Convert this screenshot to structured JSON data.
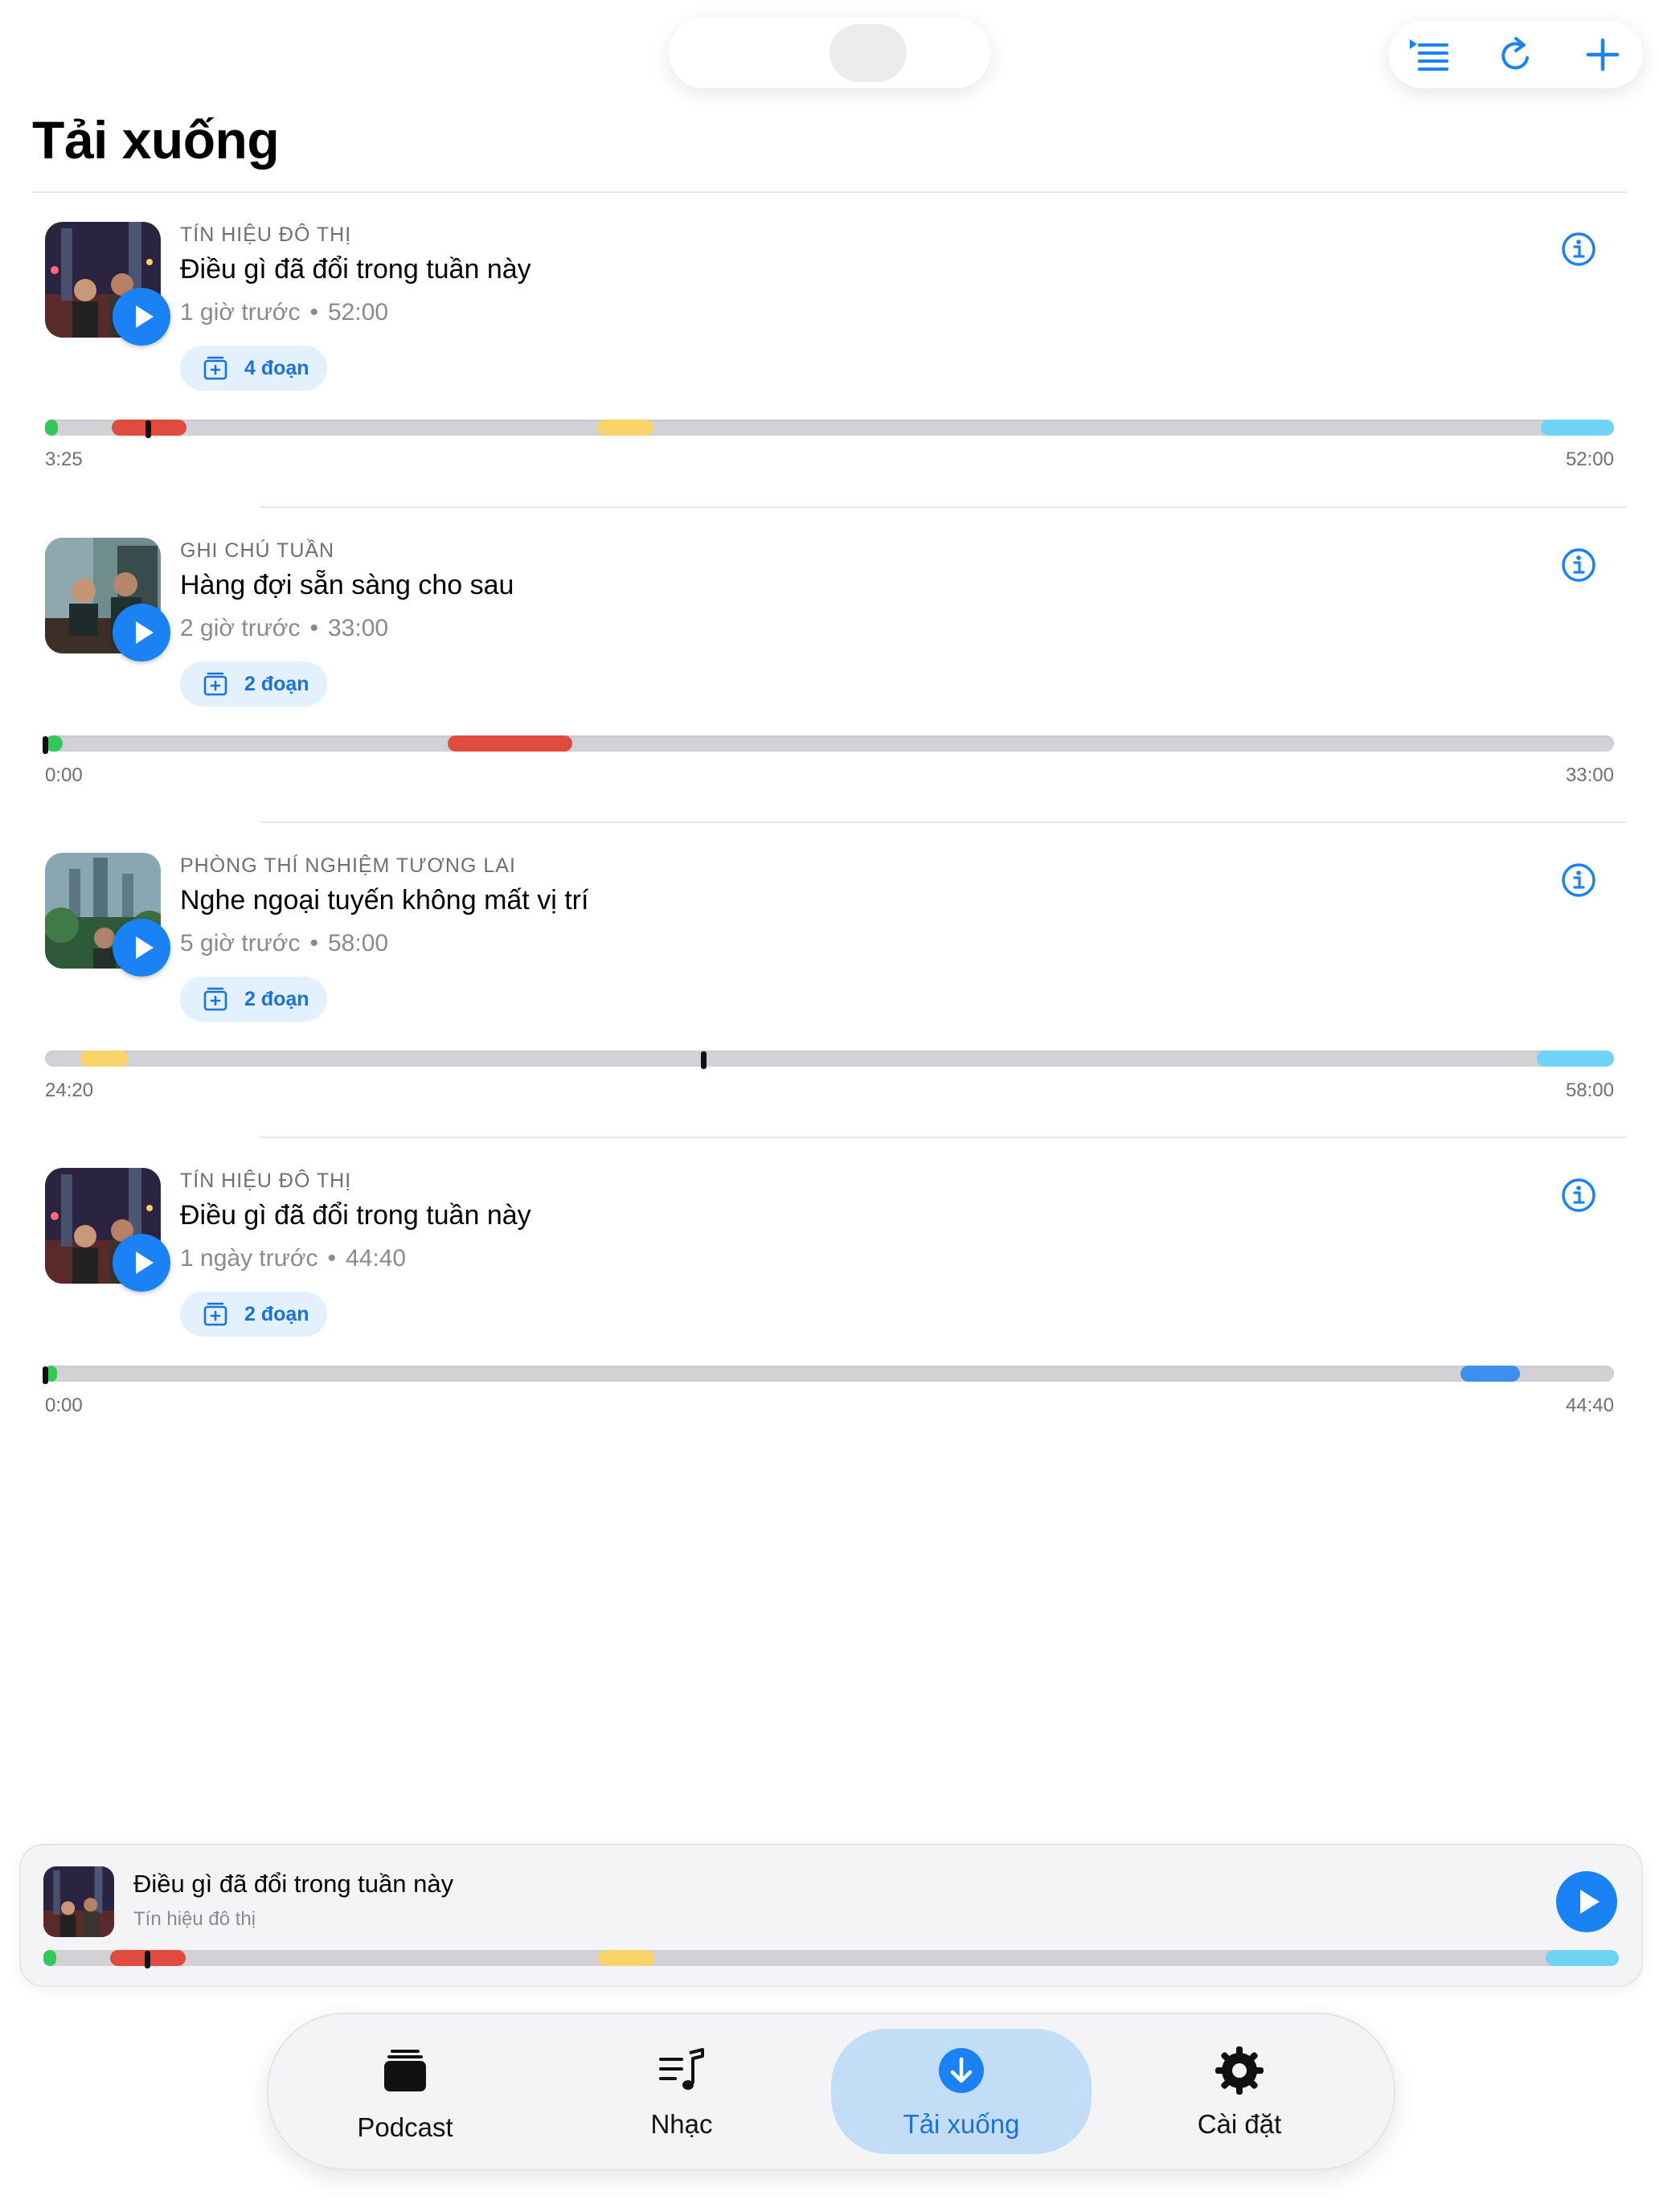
{
  "page": {
    "title": "Tải xuống"
  },
  "toolbar": {
    "icons": [
      "playlist-icon",
      "refresh-icon",
      "add-icon"
    ]
  },
  "colors": {
    "accent": "#1a82f5",
    "chip_bg": "#e3f0fd",
    "segment_green": "#34c759",
    "segment_red": "#e04b3f",
    "segment_yellow": "#f8d46a",
    "segment_cyan": "#6fd3f5",
    "segment_blue": "#3d8ff0"
  },
  "episodes": [
    {
      "show": "TÍN HIỆU ĐÔ THỊ",
      "title": "Điều gì đã đổi trong tuần này",
      "age": "1 giờ trước",
      "duration": "52:00",
      "chip": "4 đoạn",
      "art": "city-night",
      "timeline": {
        "start": "3:25",
        "end": "52:00",
        "duration_s": 3120,
        "position_s": 205,
        "segments": [
          {
            "color": "green",
            "from_s": 0,
            "to_s": 25
          },
          {
            "color": "red",
            "from_s": 132,
            "to_s": 282
          },
          {
            "color": "yellow",
            "from_s": 1098,
            "to_s": 1210
          },
          {
            "color": "cyan",
            "from_s": 2975,
            "to_s": 3120
          }
        ]
      }
    },
    {
      "show": "GHI CHÚ TUẦN",
      "title": "Hàng đợi sẵn sàng cho sau",
      "age": "2 giờ trước",
      "duration": "33:00",
      "chip": "2 đoạn",
      "art": "studio",
      "timeline": {
        "start": "0:00",
        "end": "33:00",
        "duration_s": 1980,
        "position_s": 0,
        "segments": [
          {
            "color": "green",
            "from_s": 0,
            "to_s": 22
          },
          {
            "color": "red",
            "from_s": 508,
            "to_s": 665
          }
        ]
      }
    },
    {
      "show": "PHÒNG THÍ NGHIỆM TƯƠNG LAI",
      "title": "Nghe ngoại tuyến không mất vị trí",
      "age": "5 giờ trước",
      "duration": "58:00",
      "chip": "2 đoạn",
      "art": "garden-city",
      "timeline": {
        "start": "24:20",
        "end": "58:00",
        "duration_s": 3480,
        "position_s": 1460,
        "segments": [
          {
            "color": "yellow",
            "from_s": 78,
            "to_s": 185
          },
          {
            "color": "cyan",
            "from_s": 3308,
            "to_s": 3480
          }
        ]
      }
    },
    {
      "show": "TÍN HIỆU ĐÔ THỊ",
      "title": "Điều gì đã đổi trong tuần này",
      "age": "1 ngày trước",
      "duration": "44:40",
      "chip": "2 đoạn",
      "art": "city-night",
      "timeline": {
        "start": "0:00",
        "end": "44:40",
        "duration_s": 2680,
        "position_s": 0,
        "segments": [
          {
            "color": "green",
            "from_s": 0,
            "to_s": 20
          },
          {
            "color": "blue",
            "from_s": 2418,
            "to_s": 2520
          }
        ]
      }
    }
  ],
  "mini_player": {
    "title": "Điều gì đã đổi trong tuần này",
    "subtitle": "Tín hiệu đô thị",
    "timeline": {
      "duration_s": 3120,
      "position_s": 205,
      "segments": [
        {
          "color": "green",
          "from_s": 0,
          "to_s": 25
        },
        {
          "color": "red",
          "from_s": 132,
          "to_s": 282
        },
        {
          "color": "yellow",
          "from_s": 1098,
          "to_s": 1210
        },
        {
          "color": "cyan",
          "from_s": 2975,
          "to_s": 3120
        }
      ]
    }
  },
  "tabs": [
    {
      "label": "Podcast",
      "icon": "podcast-stack-icon",
      "active": false
    },
    {
      "label": "Nhạc",
      "icon": "music-list-icon",
      "active": false
    },
    {
      "label": "Tải xuống",
      "icon": "download-icon",
      "active": true
    },
    {
      "label": "Cài đặt",
      "icon": "gear-icon",
      "active": false
    }
  ]
}
